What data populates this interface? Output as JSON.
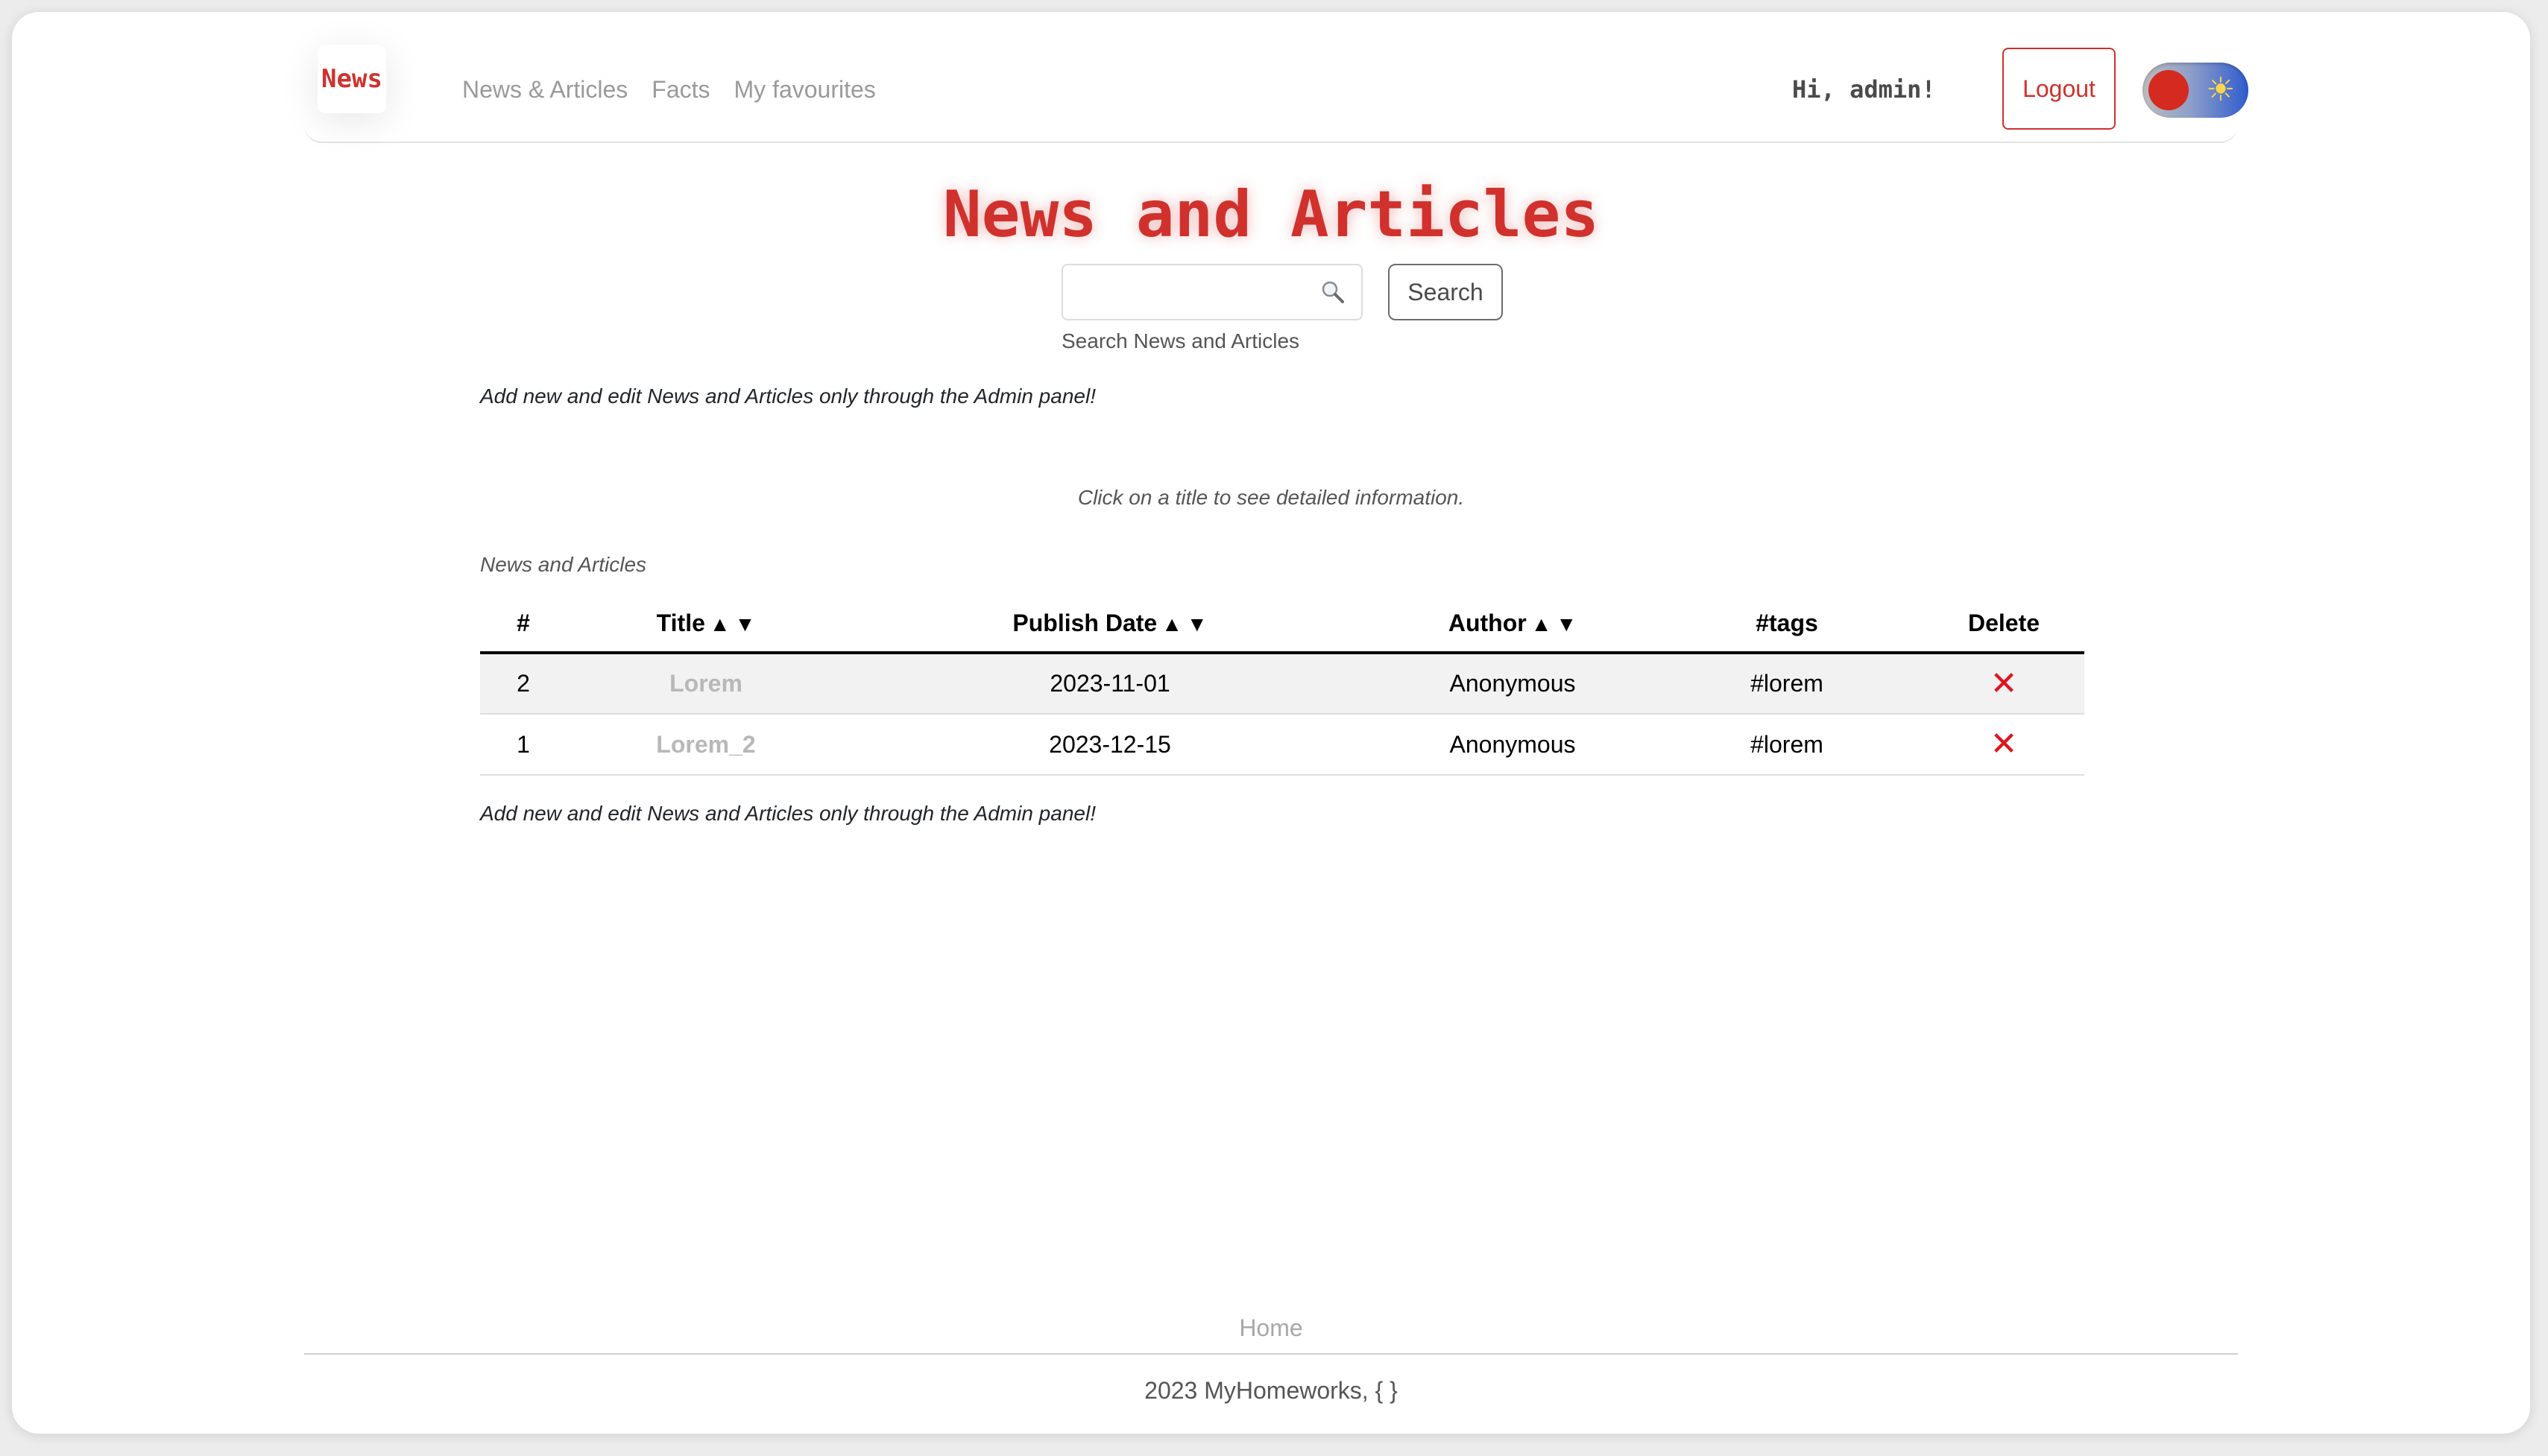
{
  "navbar": {
    "brand": "News",
    "links": [
      "News & Articles",
      "Facts",
      "My favourites"
    ],
    "greeting": "Hi, admin!",
    "logout_label": "Logout",
    "theme_toggle": {
      "state": "light",
      "knob_color": "#d42a1f",
      "track_color": "#2f5cd0"
    }
  },
  "page": {
    "title": "News and Articles",
    "search": {
      "value": "",
      "button_label": "Search",
      "hint": "Search News and Articles"
    },
    "admin_note_top": "Add new and edit News and Articles only through the Admin panel!",
    "click_hint": "Click on a title to see detailed information.",
    "table_caption": "News and Articles",
    "admin_note_bottom": "Add new and edit News and Articles only through the Admin panel!"
  },
  "table": {
    "headers": {
      "num": "#",
      "title": "Title",
      "date": "Publish Date",
      "author": "Author",
      "tags": "#tags",
      "delete": "Delete"
    },
    "sort_up": "▲",
    "sort_down": "▼",
    "rows": [
      {
        "num": "2",
        "title": "Lorem",
        "date": "2023-11-01",
        "author": "Anonymous",
        "tags": "#lorem",
        "delete": "✕"
      },
      {
        "num": "1",
        "title": "Lorem_2",
        "date": "2023-12-15",
        "author": "Anonymous",
        "tags": "#lorem",
        "delete": "✕"
      }
    ]
  },
  "footer": {
    "home_link": "Home",
    "copyright": "2023 MyHomeworks, { }"
  },
  "colors": {
    "accent": "#d0312d",
    "delete": "#e0141e",
    "muted_link": "#9a9a9a"
  }
}
